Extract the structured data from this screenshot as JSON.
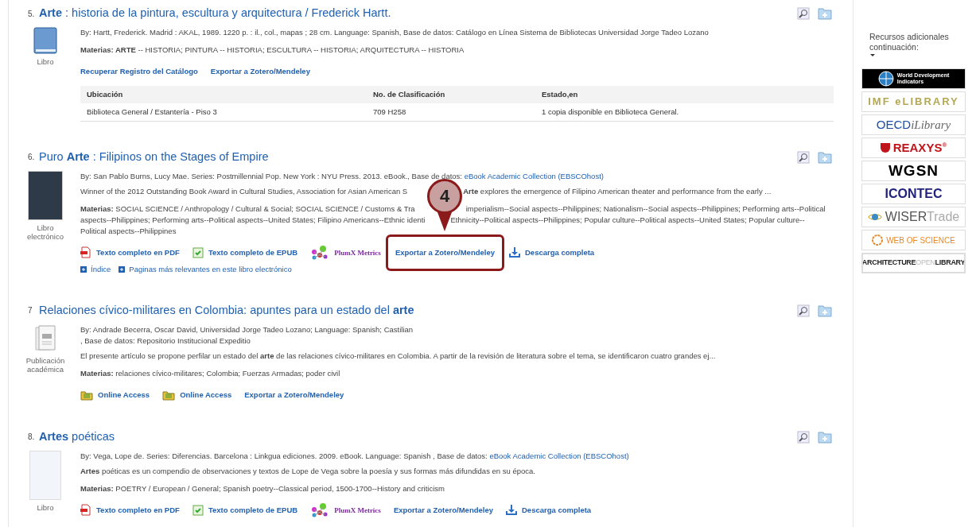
{
  "records": [
    {
      "number": "5.",
      "title": "**Arte** : historia de la pintura, escultura y arquitectura / Frederick Hartt.",
      "cover": {
        "kind": "book"
      },
      "type_label": "Libro",
      "byline": {
        "text": "By: Hartt, Frederick. Madrid : AKAL, 1989. 1220 p. : il., col., mapas ; 28 cm. Language: Spanish, Base de datos: Catálogo en Línea Sistema de Bibliotecas Universidad Jorge Tadeo Lozano"
      },
      "subjects": [
        [
          "**Materias: ARTE** -- HISTORIA; PINTURA -- HISTORIA; ESCULTURA -- HISTORIA; ARQUITECTURA -- HISTORIA"
        ]
      ],
      "links": [
        {
          "kind": "plain",
          "label": "Recuperar Registro del Catálogo",
          "highlighted": false
        },
        {
          "kind": "plain",
          "label": "Exportar a Zotero/Mendeley",
          "highlighted": false
        }
      ],
      "table": {
        "columns": [
          "Ubicación",
          "No. de Clasificación",
          "Estado,en"
        ],
        "rows": [
          [
            "Biblioteca General / Estantería - Piso 3",
            "709 H258",
            "1 copia disponible en Biblioteca General."
          ]
        ]
      }
    },
    {
      "number": "6.",
      "title": "Puro **Arte** : Filipinos on the Stages of Empire",
      "cover": {
        "kind": "ebook-photo"
      },
      "type_label": "Libro electrónico",
      "byline": {
        "text": "By: San Pablo Burns, Lucy Mae. Series: Postmillennial Pop. New York : NYU Press. 2013. eBook., Base de datos: ",
        "link": "eBook Academic Collection (EBSCOhost)"
      },
      "abstract": [
        "Winner of the 2012 Outstanding Book Award in Cultural Studies, Association for Asian American S",
        "**Arte** explores the emergence of Filipino American theater and performance from the early ..."
      ],
      "subjects": [
        [
          "**Materias:** SOCIAL SCIENCE / Anthropology / Cultural & Social; SOCIAL SCIENCE / Customs & Tra",
          "imperialism--Social aspects--Philippines; Nationalism--Social aspects--Philippines; Performing arts--Political"
        ],
        [
          "aspects--Philippines; Performing arts--Political aspects--United States; Filipino Americans--Ethnic identi",
          "Ethnicity--Political aspects--Philippines; Popular culture--Political aspects--United States; Popular culture--"
        ],
        [
          "Political aspects--Philippines"
        ]
      ],
      "links": [
        {
          "kind": "pdf",
          "label": "Texto completo en PDF",
          "highlighted": false
        },
        {
          "kind": "epub",
          "label": "Texto completo de EPUB",
          "highlighted": false
        },
        {
          "kind": "plumx",
          "label": "PlumX Metrics",
          "highlighted": false
        },
        {
          "kind": "plain",
          "label": "Exportar a Zotero/Mendeley",
          "highlighted": true
        },
        {
          "kind": "download",
          "label": "Descarga completa",
          "highlighted": false
        }
      ],
      "sublinks": [
        "Índice",
        "Paginas más relevantes en este libro electrónico"
      ],
      "callout": "4"
    },
    {
      "number": "7",
      "title": "Relaciones cívico-militares en Colombia: apuntes para un estado del **arte**",
      "cover": {
        "kind": "document"
      },
      "type_label": "Publicación académica",
      "byline": {
        "text": "By: Andrade Becerra, Oscar David, Universidad Jorge Tadeo Lozano; Language: Spanish; Castilian"
      },
      "byline_2": ", Base de datos: Repositorio Institucional Expeditio",
      "abstract": [
        "El presente artículo se propone perfilar un estado del **arte** de las relaciones cívico-militares en Colombia. A partir de la revisión de literatura sobre el tema, se identificaron cuatro grandes ej..."
      ],
      "subjects": [
        [
          "**Materias:** relaciones cívico-militares; Colombia; Fuerzas Armadas; poder civil"
        ]
      ],
      "links": [
        {
          "kind": "online",
          "label": "Online Access",
          "highlighted": false
        },
        {
          "kind": "online",
          "label": "Online Access",
          "highlighted": false
        },
        {
          "kind": "plain",
          "label": "Exportar a Zotero/Mendeley",
          "highlighted": false
        }
      ]
    },
    {
      "number": "8.",
      "title": "**Artes** poéticas",
      "cover": {
        "kind": "ebook-text"
      },
      "type_label": "Libro",
      "byline": {
        "text": "By: Vega, Lope de. Series: Diferencias. Barcelona : Linkgua ediciones. 2009. eBook. Language: Spanish , Base de datos: ",
        "link": "eBook Academic Collection (EBSCOhost)"
      },
      "abstract": [
        "**Artes** poéticas es un compendio de observaciones y textos de Lope de Vega sobre la poesía y sus formas más difundidas en su época."
      ],
      "subjects": [
        [
          "**Materias:** POETRY / European / General; Spanish poetry--Classical period, 1500-1700--History and criticism"
        ]
      ],
      "links": [
        {
          "kind": "pdf",
          "label": "Texto completo en PDF",
          "highlighted": false
        },
        {
          "kind": "epub",
          "label": "Texto completo de EPUB",
          "highlighted": false
        },
        {
          "kind": "plumx",
          "label": "PlumX Metrics",
          "highlighted": false
        },
        {
          "kind": "plain",
          "label": "Exportar a Zotero/Mendeley",
          "highlighted": false
        },
        {
          "kind": "download",
          "label": "Descarga completa",
          "highlighted": false
        }
      ]
    }
  ],
  "sidebar": {
    "heading": "Recursos adicionales continuación:",
    "logos": [
      {
        "kind": "wdi",
        "parts": [
          "World Development",
          "Indicators"
        ]
      },
      {
        "kind": "imf",
        "parts": [
          "IMF eLIBRARY"
        ]
      },
      {
        "kind": "oecd",
        "parts": [
          "OECD",
          "iLibrary"
        ]
      },
      {
        "kind": "reaxys",
        "parts": [
          "REAXYS",
          "®"
        ]
      },
      {
        "kind": "wgsn",
        "parts": [
          "WGSN"
        ]
      },
      {
        "kind": "icontec",
        "parts": [
          "ICONTEC"
        ]
      },
      {
        "kind": "wiser",
        "parts": [
          "WISER",
          "Trade"
        ]
      },
      {
        "kind": "wos",
        "parts": [
          "WEB OF SCIENCE"
        ]
      },
      {
        "kind": "aol",
        "parts": [
          "ARCHITECTURE",
          "OPEN",
          "LIBRARY"
        ]
      }
    ]
  }
}
